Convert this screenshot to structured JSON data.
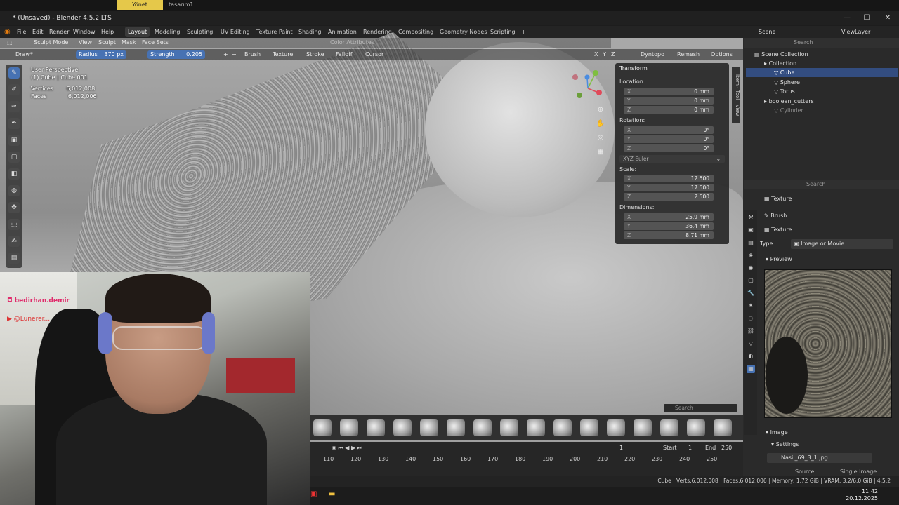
{
  "browser_tabs": {
    "active": "Yönet",
    "second": "tasarım1"
  },
  "window": {
    "title": "* (Unsaved) - Blender 4.5.2 LTS",
    "minimize": "—",
    "maximize": "☐",
    "close": "✕"
  },
  "menu": {
    "file": "File",
    "edit": "Edit",
    "render": "Render",
    "window": "Window",
    "help": "Help"
  },
  "workspaces": [
    "Layout",
    "Modeling",
    "Sculpting",
    "UV Editing",
    "Texture Paint",
    "Shading",
    "Animation",
    "Rendering",
    "Compositing",
    "Geometry Nodes",
    "Scripting"
  ],
  "add_workspace": "+",
  "scene": {
    "label": "Scene",
    "view_layer": "ViewLayer"
  },
  "viewport_header": {
    "mode": "Sculpt Mode",
    "view": "View",
    "sculpt": "Sculpt",
    "mask": "Mask",
    "face_sets": "Face Sets",
    "color_attributes": "Color Attributes"
  },
  "tool_header": {
    "brush": "Draw*",
    "radius_label": "Radius",
    "radius_value": "370 px",
    "strength_label": "Strength",
    "strength_value": "0.205",
    "plus": "+",
    "minus": "−",
    "brush_menu": "Brush",
    "texture_menu": "Texture",
    "stroke_menu": "Stroke",
    "falloff_menu": "Falloff",
    "cursor_menu": "Cursor",
    "axes": [
      "X",
      "Y",
      "Z"
    ],
    "dyntopo": "Dyntopo",
    "remesh": "Remesh",
    "options": "Options"
  },
  "viewport_info": {
    "perspective": "User Perspective",
    "object": "(1) Cube | Cube.001",
    "vertices_label": "Vertices",
    "vertices": "6,012,008",
    "faces_label": "Faces",
    "faces": "6,012,006"
  },
  "npanel": {
    "header": "Transform",
    "location_label": "Location:",
    "location": [
      {
        "axis": "X",
        "value": "0 mm"
      },
      {
        "axis": "Y",
        "value": "0 mm"
      },
      {
        "axis": "Z",
        "value": "0 mm"
      }
    ],
    "rotation_label": "Rotation:",
    "rotation": [
      {
        "axis": "X",
        "value": "0°"
      },
      {
        "axis": "Y",
        "value": "0°"
      },
      {
        "axis": "Z",
        "value": "0°"
      }
    ],
    "rotation_mode": "XYZ Euler",
    "scale_label": "Scale:",
    "scale": [
      {
        "axis": "X",
        "value": "12.500"
      },
      {
        "axis": "Y",
        "value": "17.500"
      },
      {
        "axis": "Z",
        "value": "2.500"
      }
    ],
    "dimensions_label": "Dimensions:",
    "dimensions": [
      {
        "axis": "X",
        "value": "25.9 mm"
      },
      {
        "axis": "Y",
        "value": "36.4 mm"
      },
      {
        "axis": "Z",
        "value": "8.71 mm"
      }
    ],
    "tabs": [
      "Item",
      "Tool",
      "View"
    ]
  },
  "outliner": {
    "search": "Search",
    "items": [
      {
        "label": "Scene Collection",
        "indent": 0
      },
      {
        "label": "Collection",
        "indent": 1
      },
      {
        "label": "Cube",
        "indent": 2
      },
      {
        "label": "Sphere",
        "indent": 2
      },
      {
        "label": "Torus",
        "indent": 2
      },
      {
        "label": "boolean_cutters",
        "indent": 1
      },
      {
        "label": "Cylinder",
        "indent": 2
      }
    ]
  },
  "properties": {
    "search": "Search",
    "context": "Texture",
    "brush": "Brush",
    "texture_name": "Texture",
    "type_label": "Type",
    "type_value": "Image or Movie",
    "preview_label": "Preview",
    "image_label": "Image",
    "settings_label": "Settings",
    "file_name": "Nasil_69_3_1.jpg",
    "source_label": "Source",
    "source_value": "Single Image"
  },
  "timeline": {
    "frame": "1",
    "start_label": "Start",
    "start": "1",
    "end_label": "End",
    "end": "250",
    "ticks": [
      "110",
      "120",
      "130",
      "140",
      "150",
      "160",
      "170",
      "180",
      "190",
      "200",
      "210",
      "220",
      "230",
      "240",
      "250"
    ],
    "search": "Search"
  },
  "statusbar": {
    "text": "Cube | Verts:6,012,008 | Faces:6,012,006 | Memory: 1.72 GiB | VRAM: 3.2/6.0 GiB | 4.5.2"
  },
  "webcam": {
    "instagram": "bedirhan.demir",
    "youtube": "@Lunerer..."
  },
  "clock": {
    "time": "11:42",
    "date": "20.12.2025"
  }
}
